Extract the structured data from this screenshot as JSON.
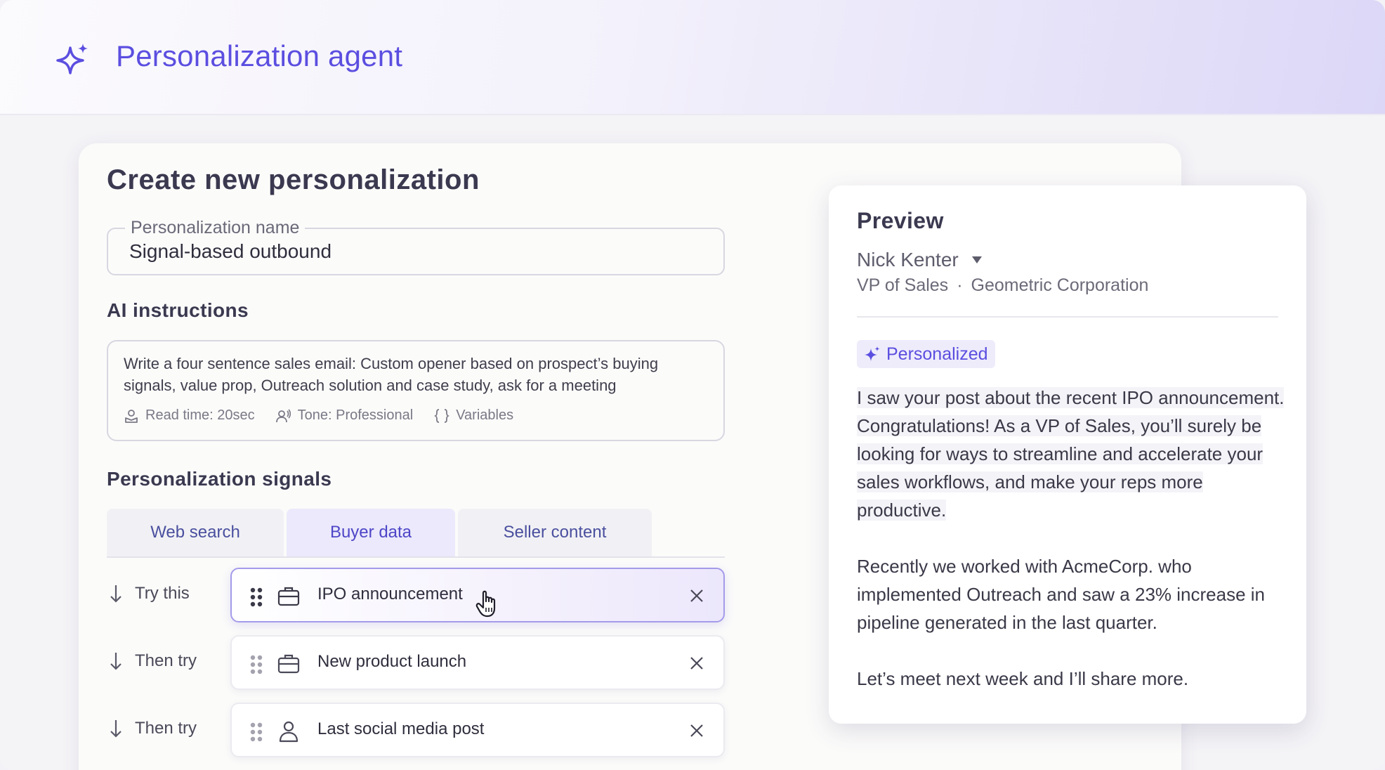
{
  "header": {
    "title": "Personalization agent"
  },
  "card": {
    "title": "Create new personalization",
    "name_field": {
      "label": "Personalization name",
      "value": "Signal-based outbound"
    },
    "ai_instructions": {
      "label": "AI instructions",
      "text": "Write a four sentence sales email: Custom opener based on prospect’s buying signals, value prop, Outreach solution and case study, ask for a meeting",
      "read_time": "Read time: 20sec",
      "tone": "Tone: Professional",
      "variables": "Variables"
    },
    "signals": {
      "label": "Personalization signals",
      "tabs": [
        {
          "label": "Web search",
          "active": false
        },
        {
          "label": "Buyer data",
          "active": true
        },
        {
          "label": "Seller content",
          "active": false
        }
      ],
      "rows": [
        {
          "step": "Try this",
          "item": "IPO announcement",
          "icon": "briefcase-icon"
        },
        {
          "step": "Then try",
          "item": "New product launch",
          "icon": "briefcase-icon"
        },
        {
          "step": "Then try",
          "item": "Last social media post",
          "icon": "person-icon"
        }
      ]
    }
  },
  "preview": {
    "title": "Preview",
    "contact_name": "Nick Kenter",
    "role": "VP of Sales",
    "separator": "·",
    "company": "Geometric Corporation",
    "badge": "Personalized",
    "personalized_text": "I saw your post about the recent IPO announcement. Congratulations! As a VP of Sales, you’ll surely be looking for ways to streamline and accelerate your sales workflows, and make your reps more productive.",
    "case_study": "Recently we worked with AcmeCorp. who implemented Outreach and saw a 23% increase in pipeline generated in the last quarter.",
    "closing": "Let’s meet next week and I’ll share more."
  },
  "colors": {
    "accent": "#5b4ee0",
    "tab_active_bg": "#ebe9fb",
    "chip_active_border": "#a49bea"
  }
}
